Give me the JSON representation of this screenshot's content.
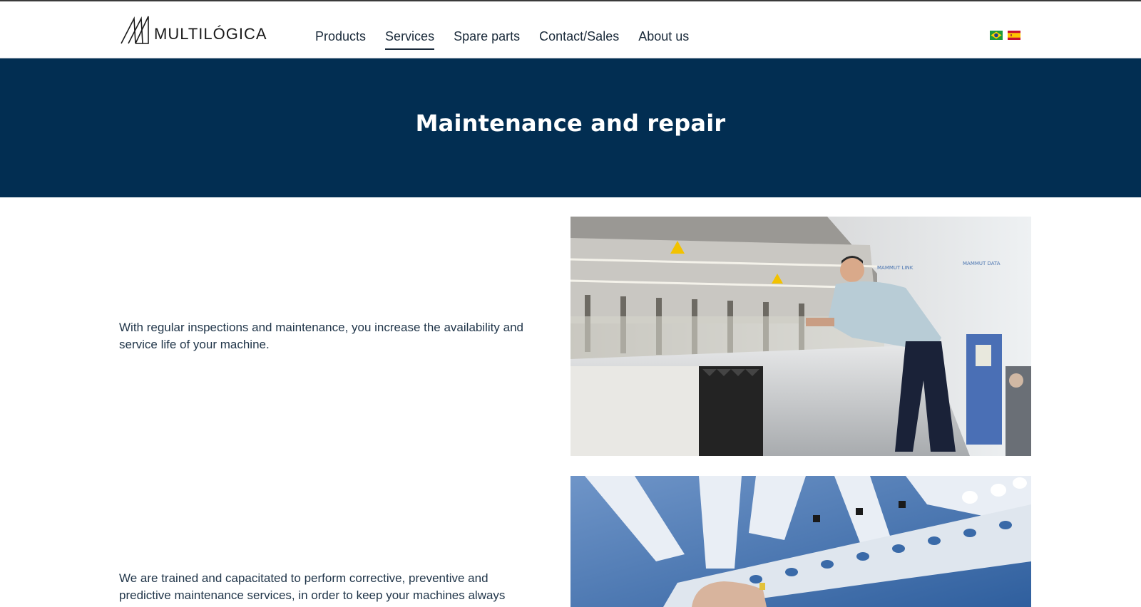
{
  "header": {
    "logo_text": "MULTILÓGICA",
    "nav": [
      {
        "label": "Products",
        "active": false
      },
      {
        "label": "Services",
        "active": true
      },
      {
        "label": "Spare parts",
        "active": false
      },
      {
        "label": "Contact/Sales",
        "active": false
      },
      {
        "label": "About us",
        "active": false
      }
    ],
    "languages": [
      {
        "icon": "brazil-flag-icon",
        "label": "Português"
      },
      {
        "icon": "spain-flag-icon",
        "label": "Español"
      }
    ]
  },
  "hero": {
    "title": "Maintenance and repair",
    "background": "#022e52"
  },
  "content": {
    "sections": [
      {
        "text": "With regular inspections and maintenance, you increase the availability and service life of your machine.",
        "image": "technician-working-on-machine-photo"
      },
      {
        "text": "We are trained and capacitated to perform corrective, preventive and predictive maintenance services, in order to keep your machines always",
        "image": "machine-parts-closeup-photo"
      }
    ]
  }
}
